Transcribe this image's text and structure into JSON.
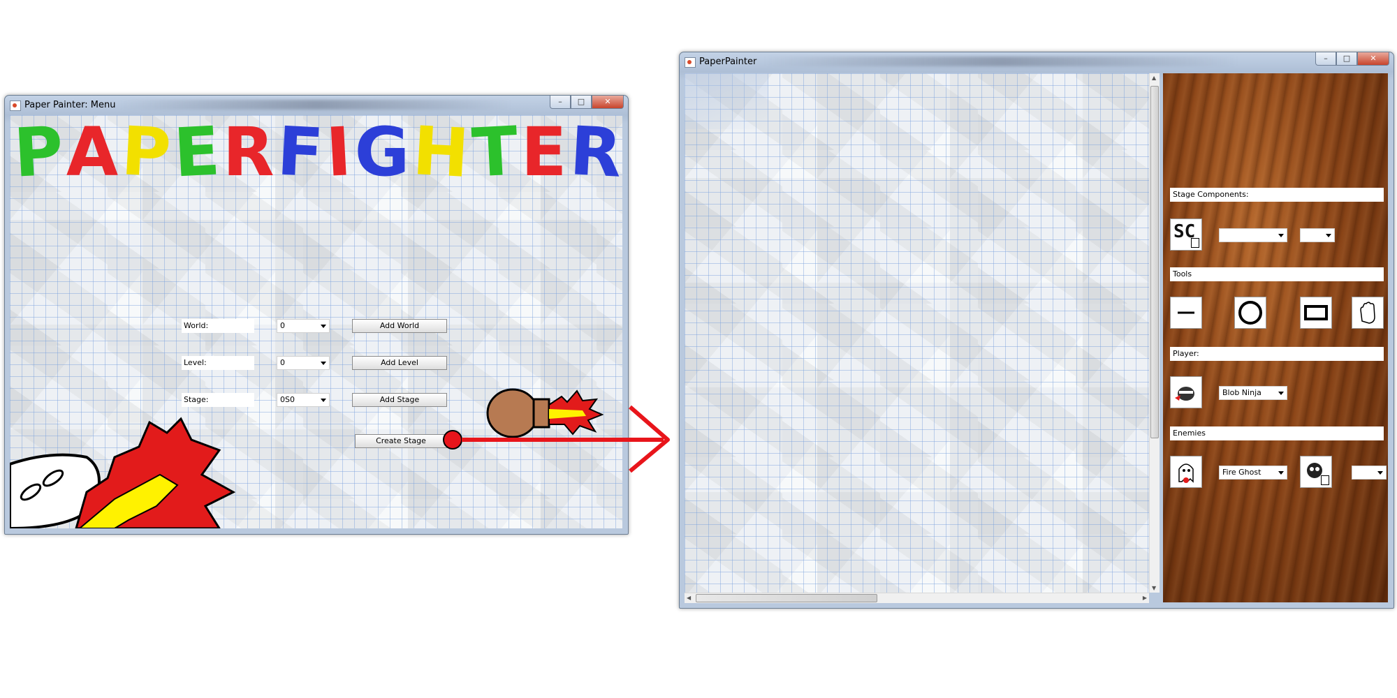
{
  "menu_window": {
    "title": "Paper Painter: Menu",
    "logo_letters": [
      "P",
      "A",
      "P",
      "E",
      "R",
      "F",
      "I",
      "G",
      "H",
      "T",
      "E",
      "R"
    ],
    "logo_colors": [
      "#2cc12c",
      "#e8262a",
      "#f2e000",
      "#2cc12c",
      "#e8262a",
      "#2c3fd8",
      "#e8262a",
      "#2c3fd8",
      "#f2e000",
      "#2cc12c",
      "#e8262a",
      "#2c3fd8"
    ],
    "world": {
      "label": "World:",
      "value": "0",
      "button": "Add World"
    },
    "level": {
      "label": "Level:",
      "value": "0",
      "button": "Add Level"
    },
    "stage": {
      "label": "Stage:",
      "value": "0S0",
      "button": "Add Stage"
    },
    "create_button": "Create Stage"
  },
  "painter_window": {
    "title": "PaperPainter",
    "stage_components_label": "Stage Components:",
    "stage_component_icon_text": "SC",
    "tools_label": "Tools",
    "tools": [
      "line-tool",
      "circle-tool",
      "rectangle-tool",
      "hand-tool"
    ],
    "player_label": "Player:",
    "player_value": "Blob Ninja",
    "enemies_label": "Enemies",
    "enemy_value": "Fire Ghost"
  },
  "colors": {
    "arrow_red": "#e8151b",
    "connector_dot": "#e8151b"
  }
}
